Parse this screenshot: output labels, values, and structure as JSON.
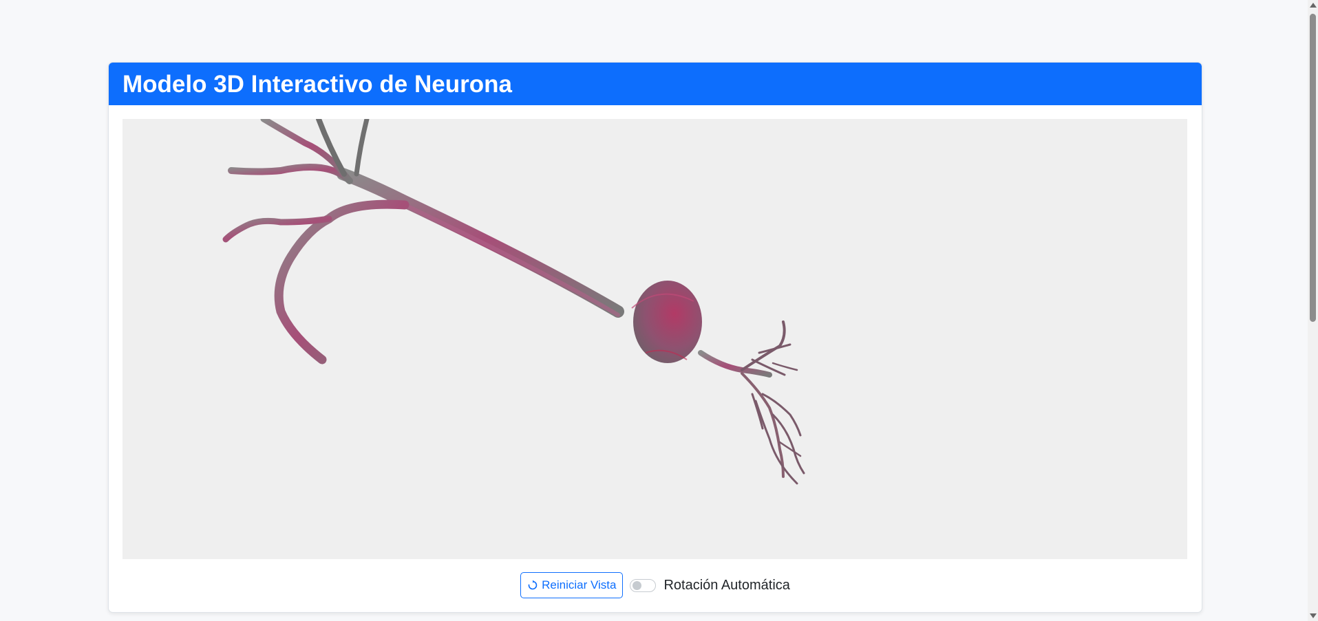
{
  "card": {
    "title": "Modelo 3D Interactivo de Neurona"
  },
  "controls": {
    "reset_button": {
      "label": "Reiniciar Vista",
      "icon": "reset-icon"
    },
    "auto_rotate": {
      "label": "Rotación Automática",
      "checked": false
    }
  },
  "colors": {
    "header": "#0d6efd",
    "viewer_bg": "#efefef",
    "neuron_pink": "#a04a70",
    "neuron_gray": "#6e6e6e"
  }
}
